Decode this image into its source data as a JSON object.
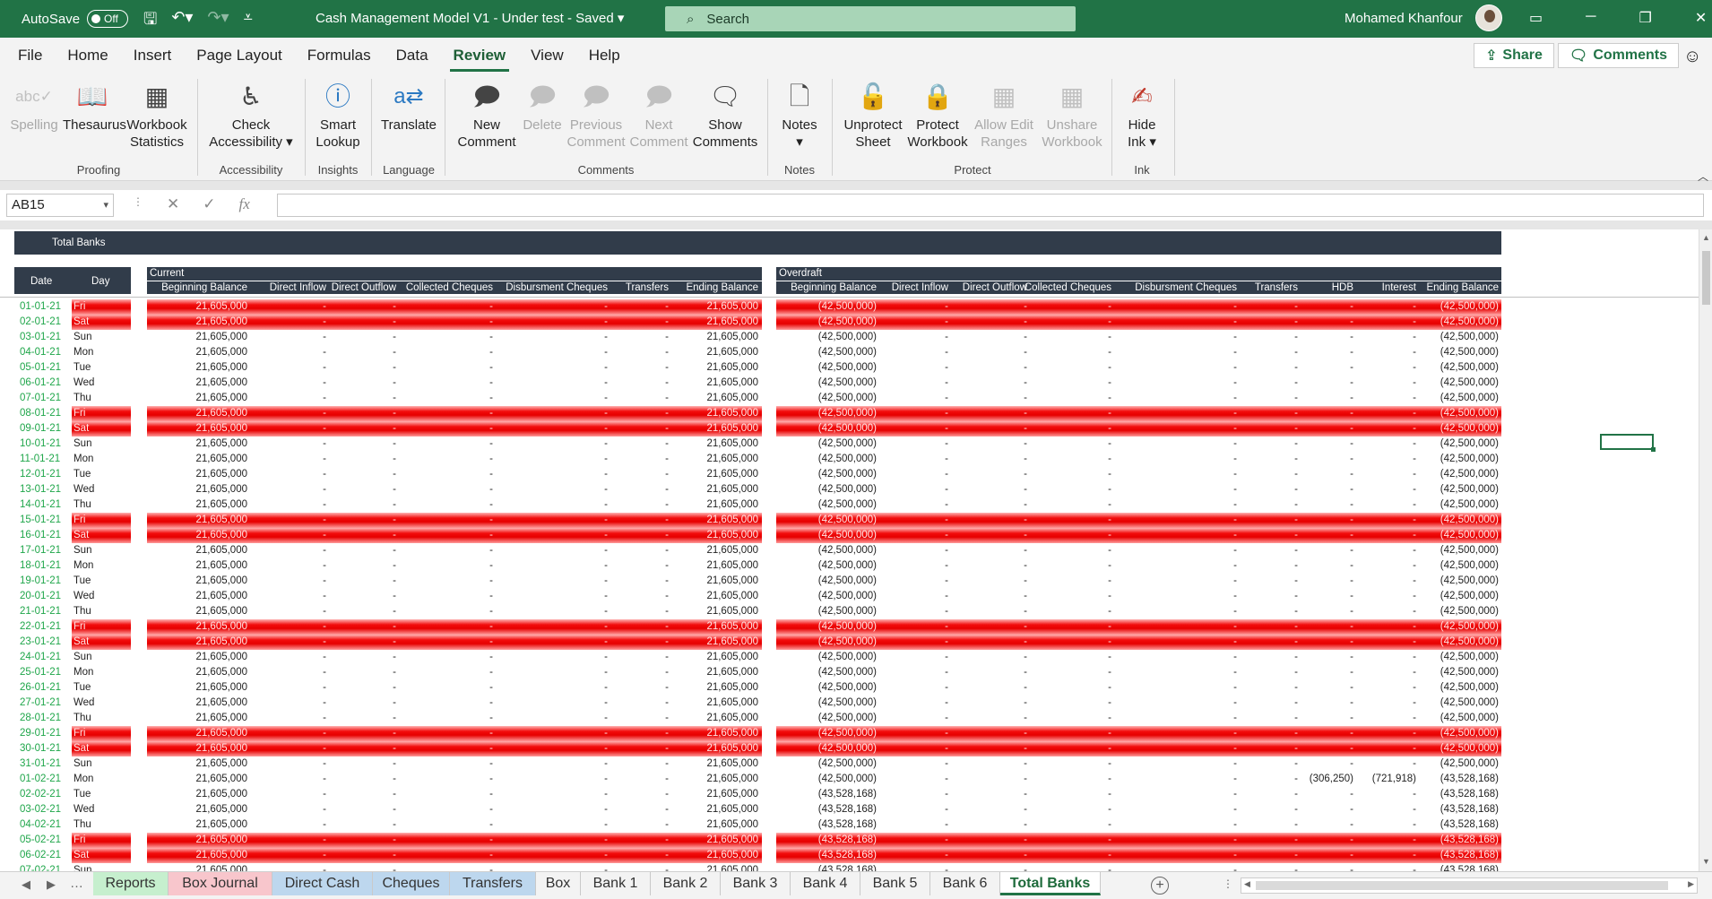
{
  "titlebar": {
    "autosave_label": "AutoSave",
    "autosave_state": "Off",
    "title": "Cash Management Model V1 - Under test  -  Saved",
    "search_placeholder": "Search",
    "user_name": "Mohamed Khanfour"
  },
  "ribbon_tabs": [
    "File",
    "Home",
    "Insert",
    "Page Layout",
    "Formulas",
    "Data",
    "Review",
    "View",
    "Help"
  ],
  "active_tab": "Review",
  "share_label": "Share",
  "comments_label": "Comments",
  "ribbon": {
    "spelling": "Spelling",
    "thesaurus": "Thesaurus",
    "workbook_statistics": [
      "Workbook",
      "Statistics"
    ],
    "check_accessibility": [
      "Check",
      "Accessibility"
    ],
    "smart_lookup": [
      "Smart",
      "Lookup"
    ],
    "translate": "Translate",
    "new_comment": [
      "New",
      "Comment"
    ],
    "delete": "Delete",
    "previous_comment": [
      "Previous",
      "Comment"
    ],
    "next_comment": [
      "Next",
      "Comment"
    ],
    "show_comments": [
      "Show",
      "Comments"
    ],
    "notes": "Notes",
    "unprotect_sheet": [
      "Unprotect",
      "Sheet"
    ],
    "protect_workbook": [
      "Protect",
      "Workbook"
    ],
    "allow_edit_ranges": [
      "Allow Edit",
      "Ranges"
    ],
    "unshare_workbook": [
      "Unshare",
      "Workbook"
    ],
    "hide_ink": [
      "Hide",
      "Ink"
    ],
    "groups": {
      "proofing": "Proofing",
      "accessibility": "Accessibility",
      "insights": "Insights",
      "language": "Language",
      "comments": "Comments",
      "notes": "Notes",
      "protect": "Protect",
      "ink": "Ink"
    }
  },
  "formula_bar": {
    "name_box": "AB15",
    "formula": ""
  },
  "sheet": {
    "title": "Total Banks",
    "date_header": "Date",
    "day_header": "Day",
    "current_label": "Current",
    "overdraft_label": "Overdraft",
    "current_columns": [
      "Beginning Balance",
      "Direct Inflow",
      "Direct Outflow",
      "Collected Cheques",
      "Disbursment Cheques",
      "Transfers",
      "Ending Balance"
    ],
    "overdraft_columns": [
      "Beginning Balance",
      "Direct Inflow",
      "Direct Outflow",
      "Collected Cheques",
      "Disbursment Cheques",
      "Transfers",
      "HDB",
      "Interest",
      "Ending Balance"
    ],
    "rows": [
      {
        "date": "01-01-21",
        "day": "Fri",
        "cur_begin": "21,605,000",
        "cur_end": "21,605,000",
        "od_begin": "(42,500,000)",
        "od_hdb": "-",
        "od_int": "-",
        "od_end": "(42,500,000)"
      },
      {
        "date": "02-01-21",
        "day": "Sat",
        "cur_begin": "21,605,000",
        "cur_end": "21,605,000",
        "od_begin": "(42,500,000)",
        "od_hdb": "-",
        "od_int": "-",
        "od_end": "(42,500,000)"
      },
      {
        "date": "03-01-21",
        "day": "Sun",
        "cur_begin": "21,605,000",
        "cur_end": "21,605,000",
        "od_begin": "(42,500,000)",
        "od_hdb": "-",
        "od_int": "-",
        "od_end": "(42,500,000)"
      },
      {
        "date": "04-01-21",
        "day": "Mon",
        "cur_begin": "21,605,000",
        "cur_end": "21,605,000",
        "od_begin": "(42,500,000)",
        "od_hdb": "-",
        "od_int": "-",
        "od_end": "(42,500,000)"
      },
      {
        "date": "05-01-21",
        "day": "Tue",
        "cur_begin": "21,605,000",
        "cur_end": "21,605,000",
        "od_begin": "(42,500,000)",
        "od_hdb": "-",
        "od_int": "-",
        "od_end": "(42,500,000)"
      },
      {
        "date": "06-01-21",
        "day": "Wed",
        "cur_begin": "21,605,000",
        "cur_end": "21,605,000",
        "od_begin": "(42,500,000)",
        "od_hdb": "-",
        "od_int": "-",
        "od_end": "(42,500,000)"
      },
      {
        "date": "07-01-21",
        "day": "Thu",
        "cur_begin": "21,605,000",
        "cur_end": "21,605,000",
        "od_begin": "(42,500,000)",
        "od_hdb": "-",
        "od_int": "-",
        "od_end": "(42,500,000)"
      },
      {
        "date": "08-01-21",
        "day": "Fri",
        "cur_begin": "21,605,000",
        "cur_end": "21,605,000",
        "od_begin": "(42,500,000)",
        "od_hdb": "-",
        "od_int": "-",
        "od_end": "(42,500,000)"
      },
      {
        "date": "09-01-21",
        "day": "Sat",
        "cur_begin": "21,605,000",
        "cur_end": "21,605,000",
        "od_begin": "(42,500,000)",
        "od_hdb": "-",
        "od_int": "-",
        "od_end": "(42,500,000)"
      },
      {
        "date": "10-01-21",
        "day": "Sun",
        "cur_begin": "21,605,000",
        "cur_end": "21,605,000",
        "od_begin": "(42,500,000)",
        "od_hdb": "-",
        "od_int": "-",
        "od_end": "(42,500,000)"
      },
      {
        "date": "11-01-21",
        "day": "Mon",
        "cur_begin": "21,605,000",
        "cur_end": "21,605,000",
        "od_begin": "(42,500,000)",
        "od_hdb": "-",
        "od_int": "-",
        "od_end": "(42,500,000)"
      },
      {
        "date": "12-01-21",
        "day": "Tue",
        "cur_begin": "21,605,000",
        "cur_end": "21,605,000",
        "od_begin": "(42,500,000)",
        "od_hdb": "-",
        "od_int": "-",
        "od_end": "(42,500,000)"
      },
      {
        "date": "13-01-21",
        "day": "Wed",
        "cur_begin": "21,605,000",
        "cur_end": "21,605,000",
        "od_begin": "(42,500,000)",
        "od_hdb": "-",
        "od_int": "-",
        "od_end": "(42,500,000)"
      },
      {
        "date": "14-01-21",
        "day": "Thu",
        "cur_begin": "21,605,000",
        "cur_end": "21,605,000",
        "od_begin": "(42,500,000)",
        "od_hdb": "-",
        "od_int": "-",
        "od_end": "(42,500,000)"
      },
      {
        "date": "15-01-21",
        "day": "Fri",
        "cur_begin": "21,605,000",
        "cur_end": "21,605,000",
        "od_begin": "(42,500,000)",
        "od_hdb": "-",
        "od_int": "-",
        "od_end": "(42,500,000)"
      },
      {
        "date": "16-01-21",
        "day": "Sat",
        "cur_begin": "21,605,000",
        "cur_end": "21,605,000",
        "od_begin": "(42,500,000)",
        "od_hdb": "-",
        "od_int": "-",
        "od_end": "(42,500,000)"
      },
      {
        "date": "17-01-21",
        "day": "Sun",
        "cur_begin": "21,605,000",
        "cur_end": "21,605,000",
        "od_begin": "(42,500,000)",
        "od_hdb": "-",
        "od_int": "-",
        "od_end": "(42,500,000)"
      },
      {
        "date": "18-01-21",
        "day": "Mon",
        "cur_begin": "21,605,000",
        "cur_end": "21,605,000",
        "od_begin": "(42,500,000)",
        "od_hdb": "-",
        "od_int": "-",
        "od_end": "(42,500,000)"
      },
      {
        "date": "19-01-21",
        "day": "Tue",
        "cur_begin": "21,605,000",
        "cur_end": "21,605,000",
        "od_begin": "(42,500,000)",
        "od_hdb": "-",
        "od_int": "-",
        "od_end": "(42,500,000)"
      },
      {
        "date": "20-01-21",
        "day": "Wed",
        "cur_begin": "21,605,000",
        "cur_end": "21,605,000",
        "od_begin": "(42,500,000)",
        "od_hdb": "-",
        "od_int": "-",
        "od_end": "(42,500,000)"
      },
      {
        "date": "21-01-21",
        "day": "Thu",
        "cur_begin": "21,605,000",
        "cur_end": "21,605,000",
        "od_begin": "(42,500,000)",
        "od_hdb": "-",
        "od_int": "-",
        "od_end": "(42,500,000)"
      },
      {
        "date": "22-01-21",
        "day": "Fri",
        "cur_begin": "21,605,000",
        "cur_end": "21,605,000",
        "od_begin": "(42,500,000)",
        "od_hdb": "-",
        "od_int": "-",
        "od_end": "(42,500,000)"
      },
      {
        "date": "23-01-21",
        "day": "Sat",
        "cur_begin": "21,605,000",
        "cur_end": "21,605,000",
        "od_begin": "(42,500,000)",
        "od_hdb": "-",
        "od_int": "-",
        "od_end": "(42,500,000)"
      },
      {
        "date": "24-01-21",
        "day": "Sun",
        "cur_begin": "21,605,000",
        "cur_end": "21,605,000",
        "od_begin": "(42,500,000)",
        "od_hdb": "-",
        "od_int": "-",
        "od_end": "(42,500,000)"
      },
      {
        "date": "25-01-21",
        "day": "Mon",
        "cur_begin": "21,605,000",
        "cur_end": "21,605,000",
        "od_begin": "(42,500,000)",
        "od_hdb": "-",
        "od_int": "-",
        "od_end": "(42,500,000)"
      },
      {
        "date": "26-01-21",
        "day": "Tue",
        "cur_begin": "21,605,000",
        "cur_end": "21,605,000",
        "od_begin": "(42,500,000)",
        "od_hdb": "-",
        "od_int": "-",
        "od_end": "(42,500,000)"
      },
      {
        "date": "27-01-21",
        "day": "Wed",
        "cur_begin": "21,605,000",
        "cur_end": "21,605,000",
        "od_begin": "(42,500,000)",
        "od_hdb": "-",
        "od_int": "-",
        "od_end": "(42,500,000)"
      },
      {
        "date": "28-01-21",
        "day": "Thu",
        "cur_begin": "21,605,000",
        "cur_end": "21,605,000",
        "od_begin": "(42,500,000)",
        "od_hdb": "-",
        "od_int": "-",
        "od_end": "(42,500,000)"
      },
      {
        "date": "29-01-21",
        "day": "Fri",
        "cur_begin": "21,605,000",
        "cur_end": "21,605,000",
        "od_begin": "(42,500,000)",
        "od_hdb": "-",
        "od_int": "-",
        "od_end": "(42,500,000)"
      },
      {
        "date": "30-01-21",
        "day": "Sat",
        "cur_begin": "21,605,000",
        "cur_end": "21,605,000",
        "od_begin": "(42,500,000)",
        "od_hdb": "-",
        "od_int": "-",
        "od_end": "(42,500,000)"
      },
      {
        "date": "31-01-21",
        "day": "Sun",
        "cur_begin": "21,605,000",
        "cur_end": "21,605,000",
        "od_begin": "(42,500,000)",
        "od_hdb": "-",
        "od_int": "-",
        "od_end": "(42,500,000)"
      },
      {
        "date": "01-02-21",
        "day": "Mon",
        "cur_begin": "21,605,000",
        "cur_end": "21,605,000",
        "od_begin": "(42,500,000)",
        "od_hdb": "(306,250)",
        "od_int": "(721,918)",
        "od_end": "(43,528,168)"
      },
      {
        "date": "02-02-21",
        "day": "Tue",
        "cur_begin": "21,605,000",
        "cur_end": "21,605,000",
        "od_begin": "(43,528,168)",
        "od_hdb": "-",
        "od_int": "-",
        "od_end": "(43,528,168)"
      },
      {
        "date": "03-02-21",
        "day": "Wed",
        "cur_begin": "21,605,000",
        "cur_end": "21,605,000",
        "od_begin": "(43,528,168)",
        "od_hdb": "-",
        "od_int": "-",
        "od_end": "(43,528,168)"
      },
      {
        "date": "04-02-21",
        "day": "Thu",
        "cur_begin": "21,605,000",
        "cur_end": "21,605,000",
        "od_begin": "(43,528,168)",
        "od_hdb": "-",
        "od_int": "-",
        "od_end": "(43,528,168)"
      },
      {
        "date": "05-02-21",
        "day": "Fri",
        "cur_begin": "21,605,000",
        "cur_end": "21,605,000",
        "od_begin": "(43,528,168)",
        "od_hdb": "-",
        "od_int": "-",
        "od_end": "(43,528,168)"
      },
      {
        "date": "06-02-21",
        "day": "Sat",
        "cur_begin": "21,605,000",
        "cur_end": "21,605,000",
        "od_begin": "(43,528,168)",
        "od_hdb": "-",
        "od_int": "-",
        "od_end": "(43,528,168)"
      },
      {
        "date": "07-02-21",
        "day": "Sun",
        "cur_begin": "21,605,000",
        "cur_end": "21,605,000",
        "od_begin": "(43,528,168)",
        "od_hdb": "-",
        "od_int": "-",
        "od_end": "(43,528,168)"
      }
    ],
    "dash": "-"
  },
  "sheet_tabs": [
    {
      "label": "Reports",
      "color": "#c6efce"
    },
    {
      "label": "Box Journal",
      "color": "#f8c6cc"
    },
    {
      "label": "Direct Cash",
      "color": "#bdd7ee"
    },
    {
      "label": "Cheques",
      "color": "#bdd7ee"
    },
    {
      "label": "Transfers",
      "color": "#bdd7ee"
    },
    {
      "label": "Box",
      "color": ""
    },
    {
      "label": "Bank 1",
      "color": ""
    },
    {
      "label": "Bank 2",
      "color": ""
    },
    {
      "label": "Bank 3",
      "color": ""
    },
    {
      "label": "Bank 4",
      "color": ""
    },
    {
      "label": "Bank 5",
      "color": ""
    },
    {
      "label": "Bank 6",
      "color": ""
    },
    {
      "label": "Total Banks",
      "color": ""
    }
  ],
  "active_sheet": "Total Banks",
  "colors": {
    "excel_green": "#217346",
    "header_dark": "#313c4a",
    "weekend_red": "#e60000",
    "date_green": "#1fa64a"
  }
}
